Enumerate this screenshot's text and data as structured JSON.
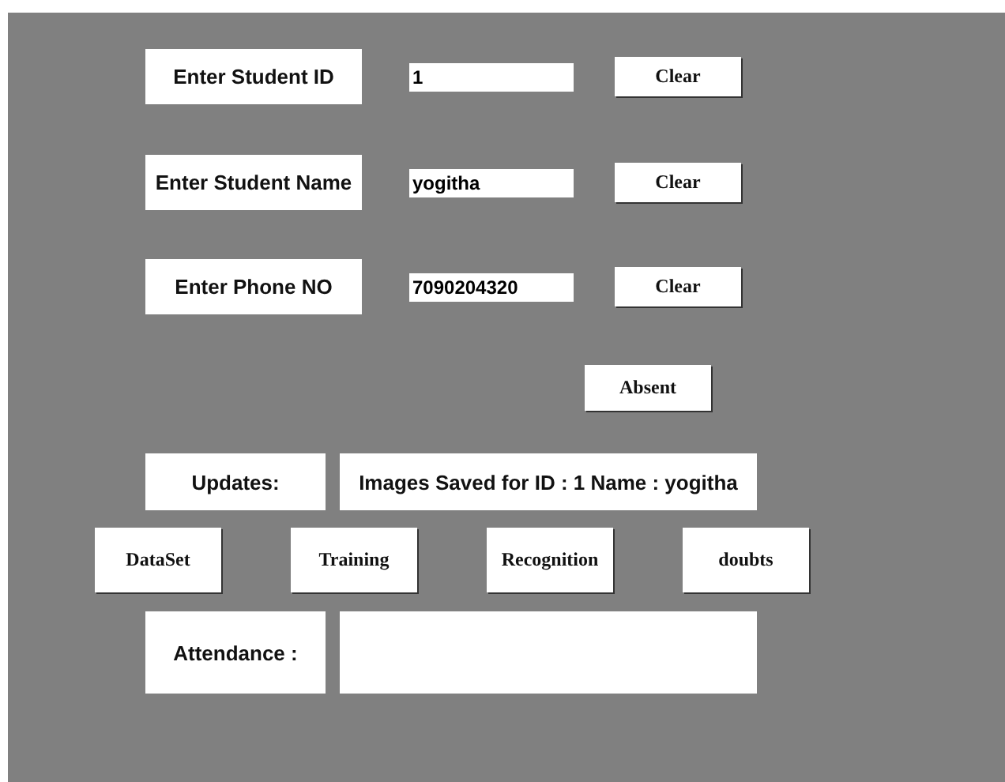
{
  "fields": [
    {
      "label": "Enter Student ID",
      "value": "1",
      "button": "Clear"
    },
    {
      "label": "Enter Student Name",
      "value": "yogitha",
      "button": "Clear"
    },
    {
      "label": "Enter Phone NO",
      "value": "7090204320",
      "button": "Clear"
    }
  ],
  "absent_button": "Absent",
  "updates": {
    "label": "Updates:",
    "message": "Images Saved for ID : 1 Name : yogitha"
  },
  "actions": [
    "DataSet",
    "Training",
    "Recognition",
    "doubts"
  ],
  "attendance": {
    "label": "Attendance :"
  }
}
